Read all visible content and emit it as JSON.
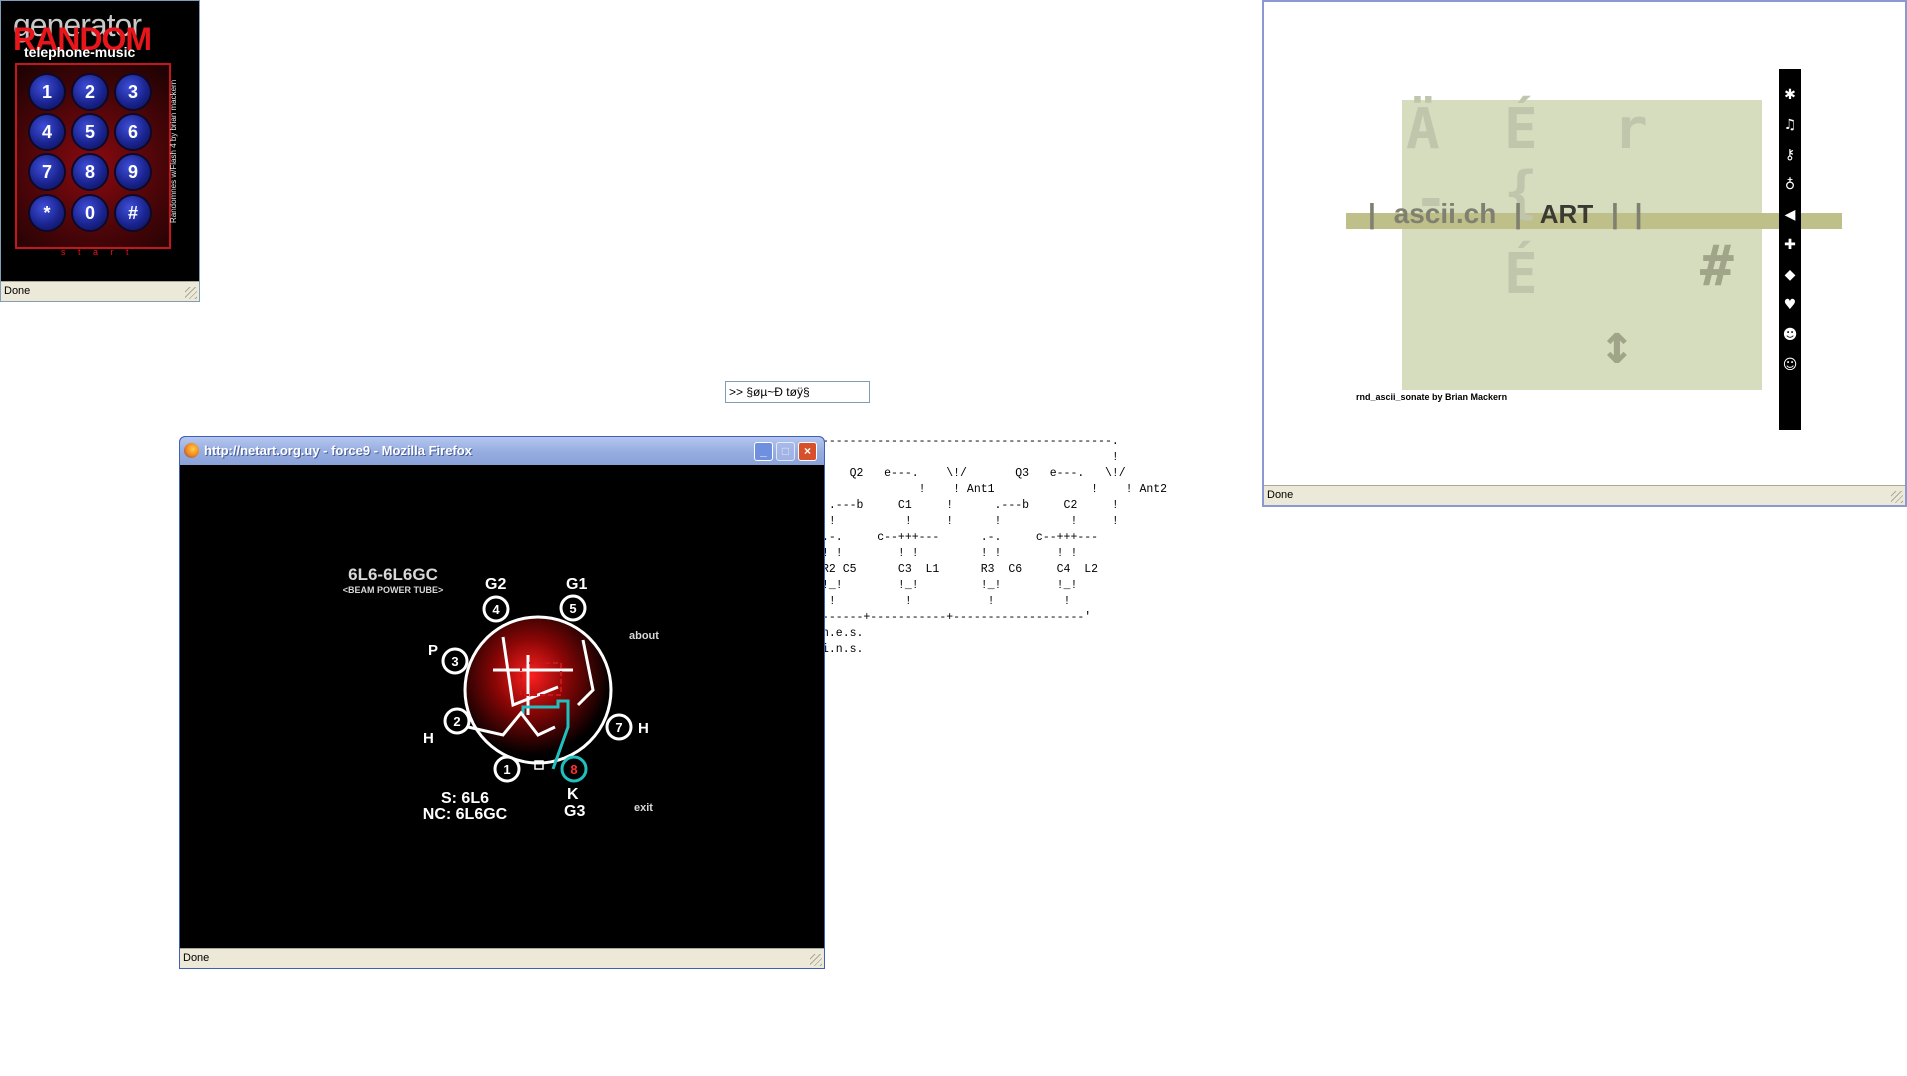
{
  "random_window": {
    "generator_text": "generator",
    "random_text": "RANDOM",
    "subtitle": "telephone-music",
    "keys": [
      "1",
      "2",
      "3",
      "4",
      "5",
      "6",
      "7",
      "8",
      "9",
      "*",
      "0",
      "#"
    ],
    "side_text": "Randomnes w/Flash 4 by brian mackern",
    "start_label": "s t a r t",
    "status": "Done",
    "colors": {
      "accent": "#e8151a",
      "key": "#1a2490"
    }
  },
  "sound_input": {
    "value": ">> §øµ~Ð tøÿ§"
  },
  "ascii_circuit": {
    "lines": [
      "------------------------------------------.",
      "                                          !",
      "    Q2   e---.    \\!/       Q3   e---.   \\!/",
      "              !    ! Ant1              !    ! Ant2",
      " .---b     C1     !      .---b     C2     !",
      " !          !     !      !          !     !",
      ".-.     c--+++---      .-.     c--+++---",
      "! !        ! !         ! !        ! !",
      "R2 C5      C3  L1      R3  C6     C4  L2",
      "!_!        !_!         !_!        !_!",
      " !          !           !          !",
      "------+-----------+-------------------'",
      "n.e.s.",
      "",
      "",
      "i.n.s."
    ],
    "links": [
      "Q2",
      "Q3",
      "Ant1",
      "Ant2",
      "C1",
      "C2",
      "R2",
      "C3",
      "R3",
      "C4",
      "L2"
    ]
  },
  "firefox_window": {
    "title": "http://netart.org.uy - force9 - Mozilla Firefox",
    "status": "Done",
    "tube": {
      "name": "6L6-6L6GC",
      "subtitle": "<BEAM POWER TUBE>",
      "pins": [
        {
          "n": "1",
          "label": ""
        },
        {
          "n": "2",
          "label": "H"
        },
        {
          "n": "3",
          "label": "P"
        },
        {
          "n": "4",
          "label": "G2"
        },
        {
          "n": "5",
          "label": "G1"
        },
        {
          "n": "7",
          "label": "H"
        },
        {
          "n": "8",
          "label": "K"
        }
      ],
      "g3_label": "G3",
      "s_text": "S: 6L6",
      "nc_text": "NC: 6L6GC",
      "about_link": "about",
      "exit_link": "exit"
    }
  },
  "ascii_art_window": {
    "top_glyphs": [
      "Ä",
      "É",
      "r"
    ],
    "mid_glyphs": [
      "É",
      "#"
    ],
    "bottom_glyph": "↕",
    "faint_glyphs": [
      "-",
      "{",
      "~"
    ],
    "line_sep": "|",
    "line_text": "ascii.ch",
    "line_art": "ART",
    "credit": "rnd_ascii_sonate by Brian Mackern",
    "toolbar_icons": [
      "asterisk-icon",
      "music-icon",
      "key-icon",
      "bomb-icon",
      "arrow-left-icon",
      "puzzle-icon",
      "diamond-icon",
      "heart-icon",
      "smiley-icon",
      "face-icon"
    ],
    "toolbar_glyphs": [
      "✱",
      "♫",
      "⚷",
      "♁",
      "◀",
      "✚",
      "◆",
      "♥",
      "☻",
      "☺"
    ],
    "status": "Done"
  }
}
